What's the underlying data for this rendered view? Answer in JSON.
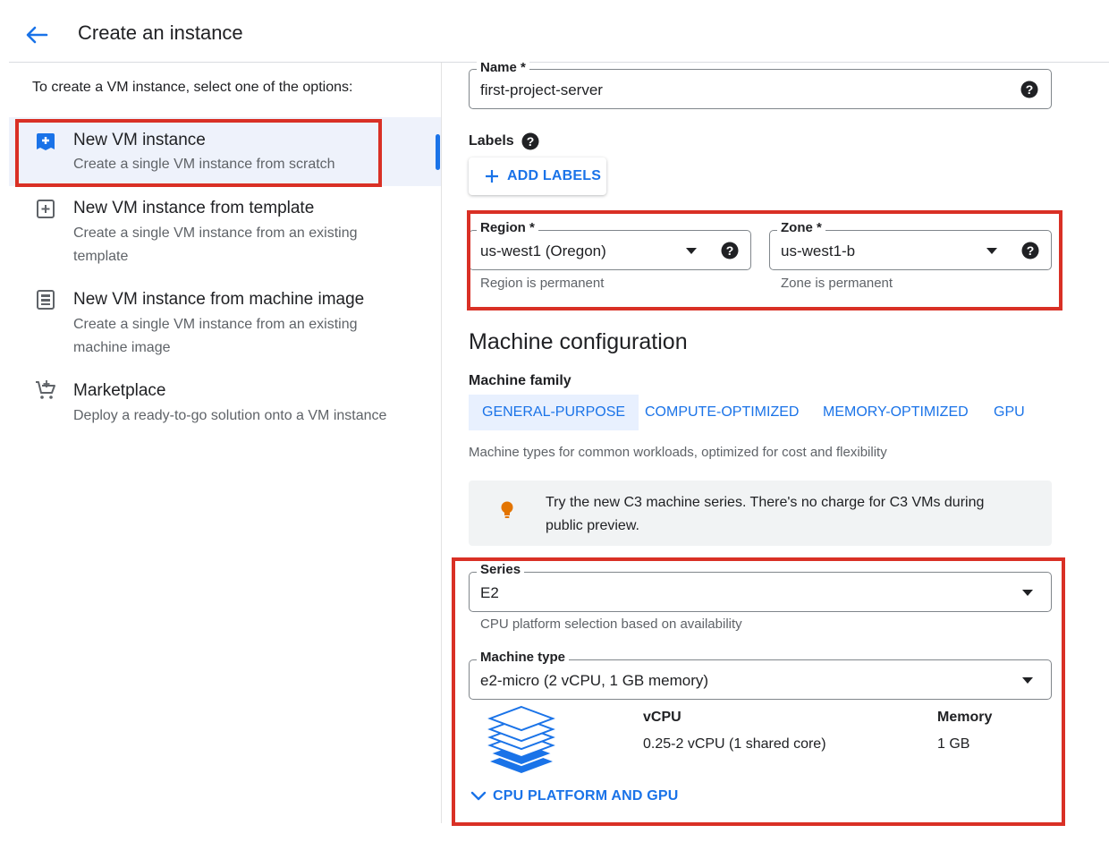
{
  "header": {
    "title": "Create an instance"
  },
  "left": {
    "intro": "To create a VM instance, select one of the options:",
    "options": [
      {
        "title": "New VM instance",
        "desc": "Create a single VM instance from scratch",
        "icon": "add-box-filled-icon"
      },
      {
        "title": "New VM instance from template",
        "desc": "Create a single VM instance from an existing template",
        "icon": "add-box-outline-icon"
      },
      {
        "title": "New VM instance from machine image",
        "desc": "Create a single VM instance from an existing machine image",
        "icon": "machine-image-icon"
      },
      {
        "title": "Marketplace",
        "desc": "Deploy a ready-to-go solution onto a VM instance",
        "icon": "cart-icon"
      }
    ]
  },
  "form": {
    "name": {
      "label": "Name *",
      "value": "first-project-server"
    },
    "labels": {
      "label": "Labels",
      "add_button": "ADD LABELS"
    },
    "region": {
      "label": "Region *",
      "value": "us-west1 (Oregon)",
      "hint": "Region is permanent"
    },
    "zone": {
      "label": "Zone *",
      "value": "us-west1-b",
      "hint": "Zone is permanent"
    },
    "machine_config": {
      "heading": "Machine configuration",
      "family_label": "Machine family",
      "tabs": [
        "GENERAL-PURPOSE",
        "COMPUTE-OPTIMIZED",
        "MEMORY-OPTIMIZED",
        "GPU"
      ],
      "family_desc": "Machine types for common workloads, optimized for cost and flexibility",
      "info": "Try the new C3 machine series. There's no charge for C3 VMs during public preview.",
      "series": {
        "label": "Series",
        "value": "E2",
        "hint": "CPU platform selection based on availability"
      },
      "machine_type": {
        "label": "Machine type",
        "value": "e2-micro (2 vCPU, 1 GB memory)"
      },
      "specs": {
        "vcpu_head": "vCPU",
        "vcpu_val": "0.25-2 vCPU (1 shared core)",
        "mem_head": "Memory",
        "mem_val": "1 GB"
      },
      "expand": "CPU PLATFORM AND GPU"
    }
  },
  "colors": {
    "accent": "#1a73e8",
    "highlight": "#d93025",
    "selected_bg": "#eef2fb"
  }
}
